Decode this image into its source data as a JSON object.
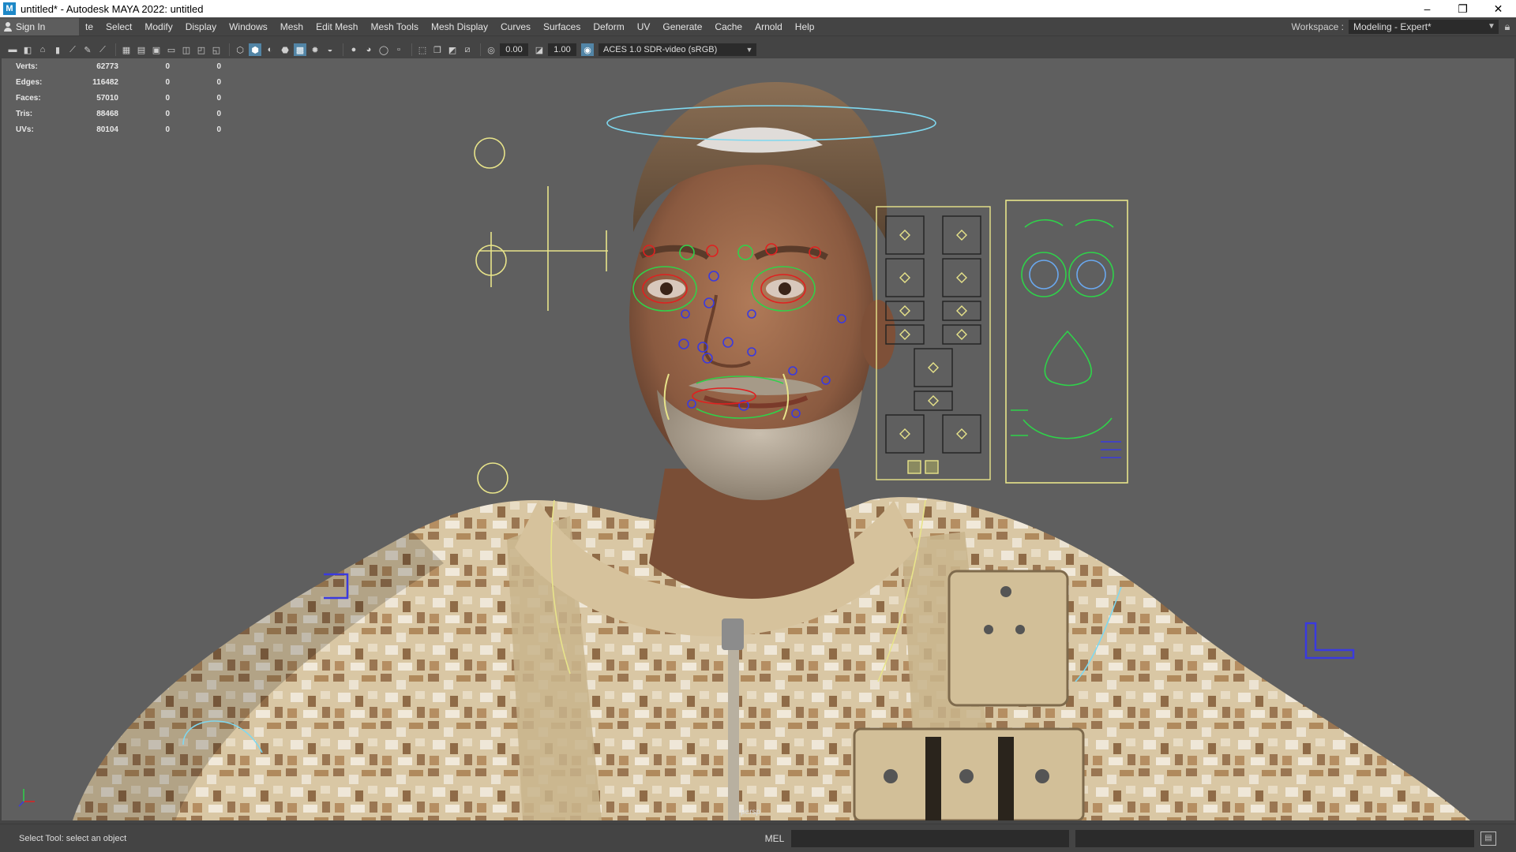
{
  "window": {
    "title": "untitled* - Autodesk MAYA 2022: untitled",
    "app_icon": "M",
    "minimize": "–",
    "restore": "❐",
    "close": "✕"
  },
  "menubar": {
    "sign_in": "Sign In",
    "items": [
      "te",
      "Select",
      "Modify",
      "Display",
      "Windows",
      "Mesh",
      "Edit Mesh",
      "Mesh Tools",
      "Mesh Display",
      "Curves",
      "Surfaces",
      "Deform",
      "UV",
      "Generate",
      "Cache",
      "Arnold",
      "Help"
    ],
    "workspace_label": "Workspace :",
    "workspace_value": "Modeling - Expert*"
  },
  "panel_toolbar": {
    "exposure": "0.00",
    "gamma": "1.00",
    "color_space": "ACES 1.0 SDR-video (sRGB)"
  },
  "hud": {
    "rows": [
      {
        "label": "Verts:",
        "v1": "62773",
        "v2": "0",
        "v3": "0"
      },
      {
        "label": "Edges:",
        "v1": "116482",
        "v2": "0",
        "v3": "0"
      },
      {
        "label": "Faces:",
        "v1": "57010",
        "v2": "0",
        "v3": "0"
      },
      {
        "label": "Tris:",
        "v1": "88468",
        "v2": "0",
        "v3": "0"
      },
      {
        "label": "UVs:",
        "v1": "80104",
        "v2": "0",
        "v3": "0"
      }
    ],
    "camera": "persp"
  },
  "statusbar": {
    "message": "Select Tool: select an object",
    "mel_label": "MEL"
  },
  "colors": {
    "viewport_bg": "#5f5f5f",
    "ui_bg": "#444444",
    "rig_yellow": "#e8e48a",
    "rig_green": "#2fd24a",
    "rig_red": "#e02020",
    "rig_blue": "#3a3adf",
    "rig_cyan": "#7fd8ef"
  }
}
